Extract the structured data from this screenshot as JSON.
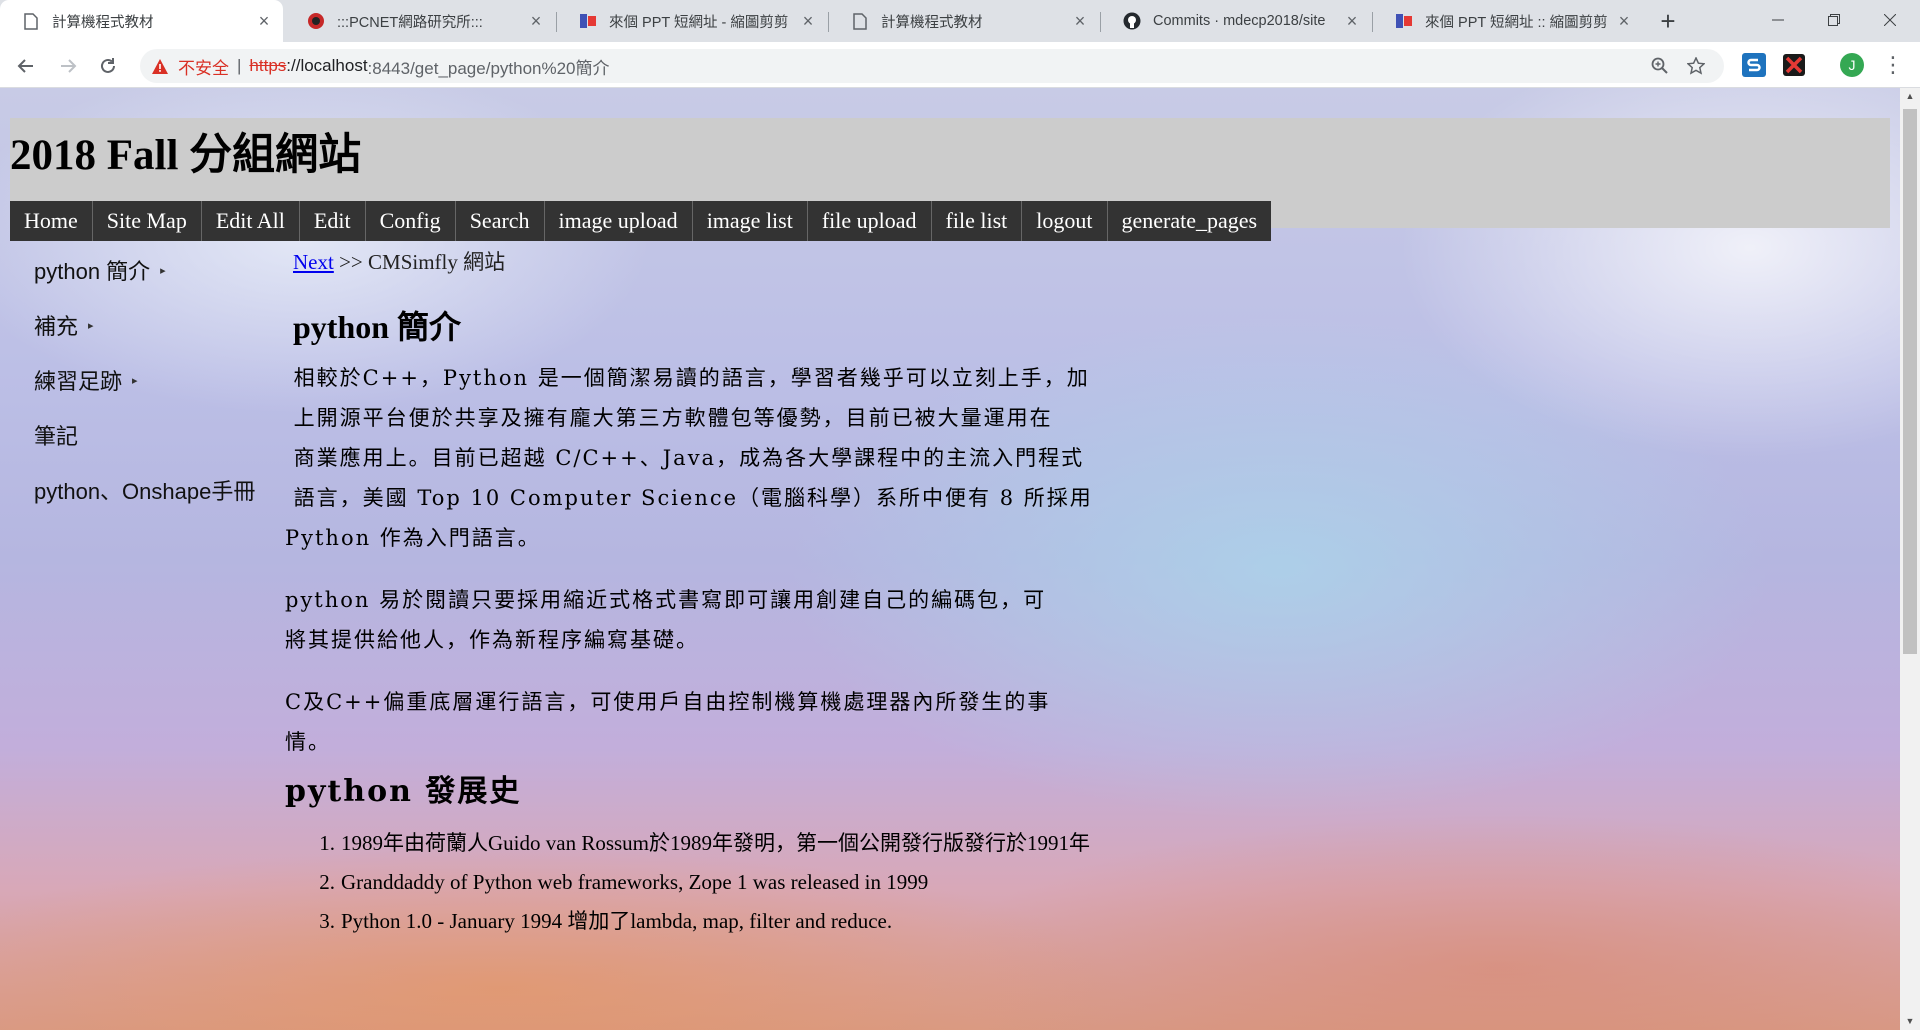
{
  "browser": {
    "tabs": [
      {
        "title": "計算機程式教材",
        "icon": "document-icon",
        "active": true
      },
      {
        "title": ":::PCNET網路研究所:::",
        "icon": "pcnet-icon",
        "active": false
      },
      {
        "title": "來個 PPT 短網址 - 縮圖剪剪",
        "icon": "ppt-icon",
        "active": false
      },
      {
        "title": "計算機程式教材",
        "icon": "document-icon",
        "active": false
      },
      {
        "title": "Commits · mdecp2018/site",
        "icon": "github-icon",
        "active": false
      },
      {
        "title": "來個 PPT 短網址 :: 縮圖剪剪",
        "icon": "ppt-icon",
        "active": false
      }
    ],
    "tab_close_glyph": "×",
    "new_tab_glyph": "+",
    "omnibox": {
      "security_label": "不安全",
      "divider": "|",
      "scheme": "https",
      "host": "://localhost",
      "path": ":8443/get_page/python%20簡介"
    },
    "profile_initial": "J"
  },
  "site": {
    "title": "2018 Fall 分組網站",
    "nav": [
      "Home",
      "Site Map",
      "Edit All",
      "Edit",
      "Config",
      "Search",
      "image upload",
      "image list",
      "file upload",
      "file list",
      "logout",
      "generate_pages"
    ]
  },
  "sidebar": {
    "items": [
      {
        "label": "python 簡介",
        "has_arrow": true
      },
      {
        "label": "補充",
        "has_arrow": true
      },
      {
        "label": "練習足跡",
        "has_arrow": true
      },
      {
        "label": "筆記",
        "has_arrow": false
      },
      {
        "label": "python、Onshape手冊",
        "has_arrow": false
      }
    ],
    "arrow_glyph": "▸"
  },
  "content": {
    "breadcrumb": {
      "link": "Next",
      "separator": " >> ",
      "current": "CMSimfly 網站"
    },
    "heading": "python 簡介",
    "para1_lines": [
      " 相較於C++，Python 是一個簡潔易讀的語言，學習者幾乎可以立刻上手，加",
      " 上開源平台便於共享及擁有龐大第三方軟體包等優勢，目前已被大量運用在",
      " 商業應用上。目前已超越 C/C++、Java，成為各大學課程中的主流入門程式",
      " 語言，美國 Top 10 Computer Science（電腦科學）系所中便有 8 所採用",
      "Python 作為入門語言。"
    ],
    "para2_lines": [
      "python 易於閱讀只要採用縮近式格式書寫即可讓用創建自己的編碼包，可",
      "將其提供給他人，作為新程序編寫基礎。"
    ],
    "para3_lines": [
      "C及C++偏重底層運行語言，可使用戶自由控制機算機處理器內所發生的事",
      "情。"
    ],
    "history_heading": "python 發展史",
    "history": [
      {
        "num": "1.",
        "text": "1989年由荷蘭人Guido van Rossum於1989年發明，第一個公開發行版發行於1991年"
      },
      {
        "num": "2.",
        "text": "Granddaddy of Python web frameworks, Zope 1 was released in 1999"
      },
      {
        "num": "3.",
        "text": "Python 1.0 - January 1994 增加了lambda, map, filter and reduce."
      }
    ]
  }
}
